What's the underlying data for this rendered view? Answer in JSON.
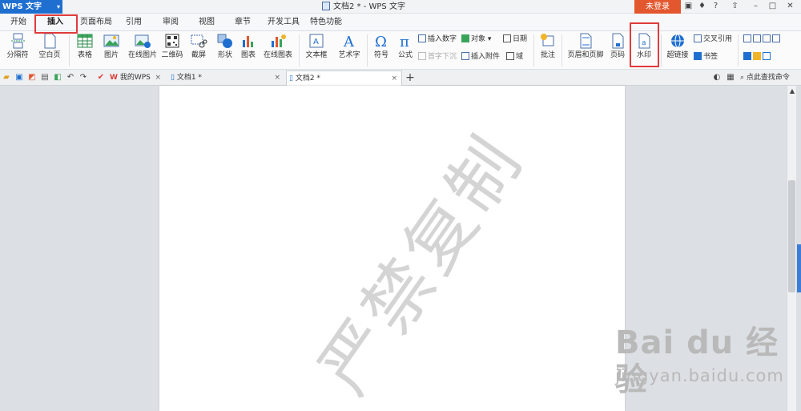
{
  "app": {
    "menu_label": "WPS 文字",
    "window_title": "文档2 * - WPS 文字",
    "login_label": "未登录"
  },
  "tabs": [
    "开始",
    "插入",
    "页面布局",
    "引用",
    "审阅",
    "视图",
    "章节",
    "开发工具",
    "特色功能"
  ],
  "active_tab": "插入",
  "ribbon": {
    "page_break": "分隔符",
    "blank_page": "空白页",
    "table": "表格",
    "picture": "图片",
    "online_picture": "在线图片",
    "qrcode": "二维码",
    "screenshot": "截屏",
    "shapes": "形状",
    "chart": "图表",
    "online_chart": "在线图表",
    "textbox": "文本框",
    "wordart": "艺术字",
    "symbol": "符号",
    "formula": "公式",
    "insert_number": "插入数字",
    "object": "对象",
    "date": "日期",
    "drop_cap": "首字下沉",
    "attachment": "插入附件",
    "field": "域",
    "comment": "批注",
    "header_footer": "页眉和页脚",
    "page_number": "页码",
    "watermark": "水印",
    "hyperlink": "超链接",
    "cross_ref": "交叉引用",
    "bookmark": "书签"
  },
  "doc_tabs": [
    {
      "label": "我的WPS"
    },
    {
      "label": "文档1 *"
    },
    {
      "label": "文档2 *"
    }
  ],
  "search_label": "点此查找命令",
  "page": {
    "watermark_text": "严禁复制"
  },
  "baidu": {
    "logo": "Bai du 经验",
    "url": "jingyan.baidu.com"
  },
  "colors": {
    "accent": "#1f6fd0",
    "login": "#e3572f",
    "highlight": "#e03b3b"
  }
}
